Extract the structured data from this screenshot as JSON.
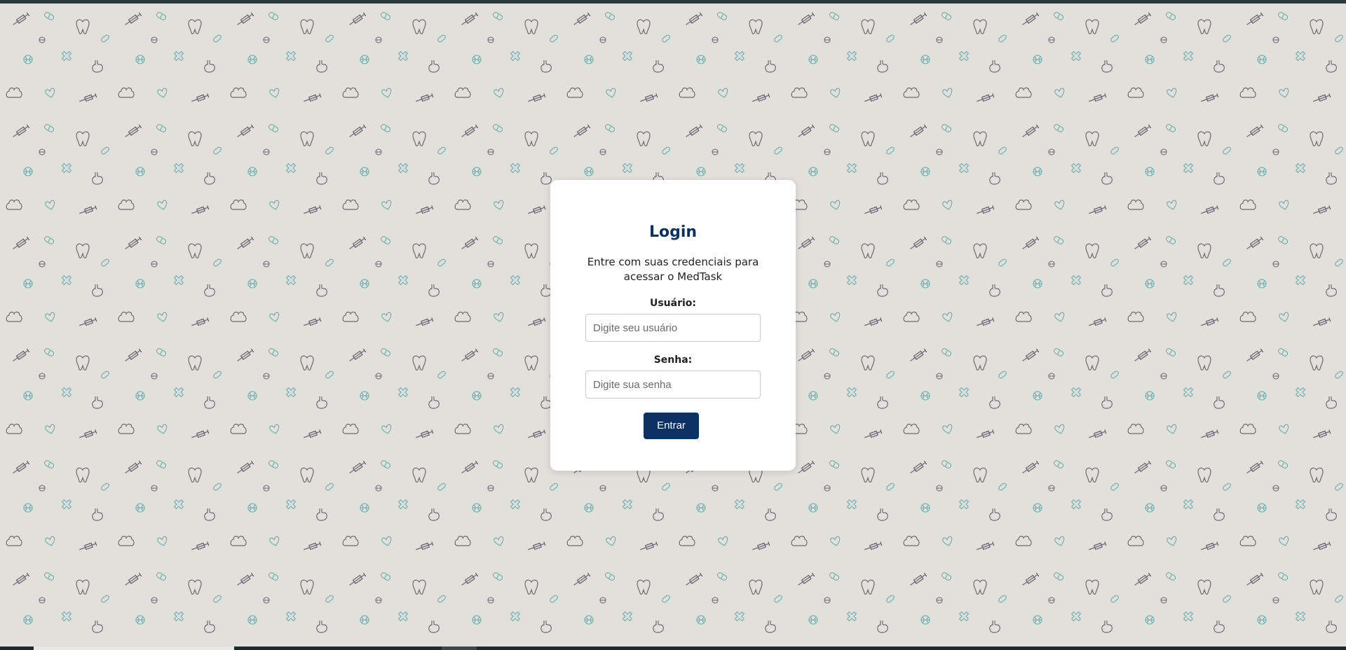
{
  "login": {
    "title": "Login",
    "subtitle": "Entre com suas credenciais para acessar o MedTask",
    "username_label": "Usuário:",
    "username_placeholder": "Digite seu usuário",
    "username_value": "",
    "password_label": "Senha:",
    "password_placeholder": "Digite sua senha",
    "password_value": "",
    "submit_label": "Entrar"
  },
  "colors": {
    "background": "#e3dfdb",
    "brand": "#0b3263",
    "pattern_dark": "#6a6878",
    "pattern_teal": "#6fb2b3"
  },
  "background_icons": [
    "syringe-icon",
    "pill-icon",
    "tooth-icon",
    "virus-icon",
    "cross-icon",
    "stomach-icon",
    "lungs-icon",
    "heart-icon"
  ]
}
